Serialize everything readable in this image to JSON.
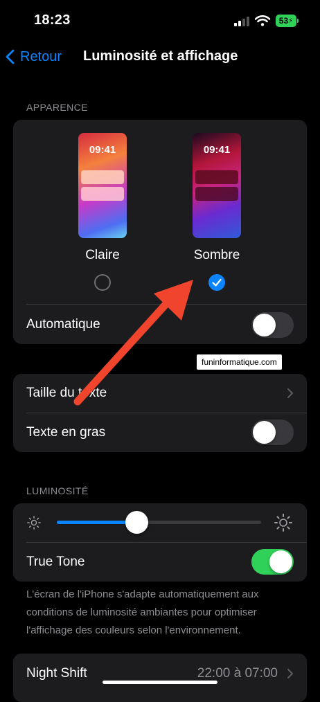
{
  "status_bar": {
    "time": "18:23",
    "battery": "53"
  },
  "nav": {
    "back_label": "Retour",
    "title": "Luminosité et affichage"
  },
  "appearance": {
    "header": "APPARENCE",
    "preview_time": "09:41",
    "light_label": "Claire",
    "dark_label": "Sombre",
    "selected": "Sombre",
    "automatic_label": "Automatique",
    "automatic_on": false
  },
  "text_group": {
    "text_size_label": "Taille du texte",
    "bold_text_label": "Texte en gras",
    "bold_text_on": false
  },
  "brightness": {
    "header": "LUMINOSITÉ",
    "slider_level_percent": 39,
    "true_tone_label": "True Tone",
    "true_tone_on": true,
    "footer": "L'écran de l'iPhone s'adapte automatiquement aux conditions de luminosité ambiantes pour optimiser l'affichage des couleurs selon l'environnement."
  },
  "night_shift": {
    "label": "Night Shift",
    "value": "22:00 à 07:00"
  },
  "watermark": "funinformatique.com",
  "colors": {
    "accent": "#0a84ff",
    "switch_on": "#30d158",
    "arrow": "#f0442c",
    "card": "#1c1c1e"
  }
}
